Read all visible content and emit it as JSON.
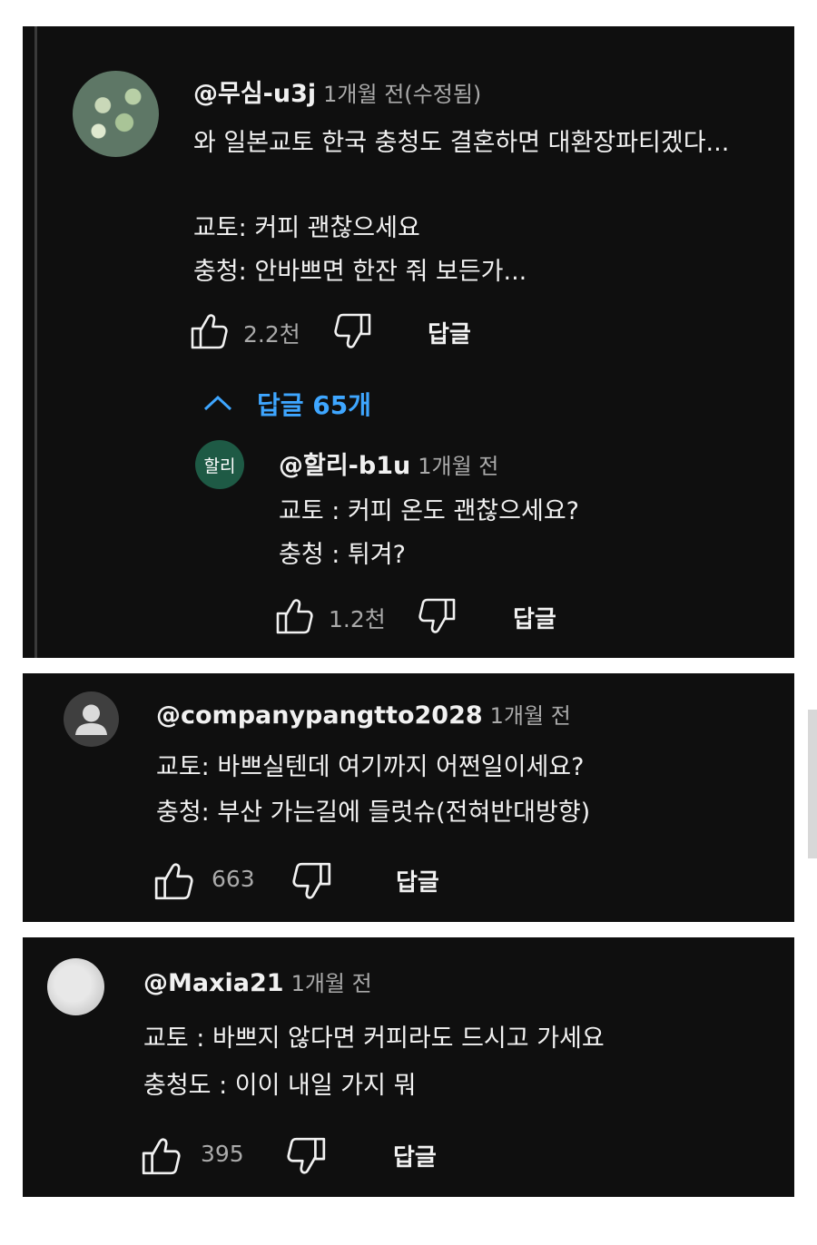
{
  "comments": [
    {
      "author": "@무심-u3j",
      "time": "1개월 전(수정됨)",
      "lines": [
        "와 일본교토 한국 충청도 결혼하면 대환장파티겠다...",
        "",
        "교토: 커피 괜찮으세요",
        "충청: 안바쁘면 한잔 줘 보든가..."
      ],
      "likes": "2.2천",
      "reply_label": "답글",
      "replies_toggle": "답글 65개",
      "reply": {
        "avatar_text": "할리",
        "avatar_color": "#1e5a45",
        "author": "@할리-b1u",
        "time": "1개월 전",
        "lines": [
          "교토 : 커피 온도 괜찮으세요?",
          "충청 : 튀겨?"
        ],
        "likes": "1.2천",
        "reply_label": "답글"
      }
    },
    {
      "author": "@companypangtto2028",
      "time": "1개월 전",
      "lines": [
        "교토: 바쁘실텐데 여기까지 어쩐일이세요?",
        "충청: 부산 가는길에 들럿슈(전혀반대방향)"
      ],
      "likes": "663",
      "reply_label": "답글"
    },
    {
      "author": "@Maxia21",
      "time": "1개월 전",
      "lines": [
        "교토 : 바쁘지 않다면 커피라도 드시고 가세요",
        "충청도 : 이이 내일 가지 뭐"
      ],
      "likes": "395",
      "reply_label": "답글"
    }
  ],
  "colors": {
    "background": "#0f0f0f",
    "text": "#f1f1f1",
    "secondary": "#aaaaaa",
    "link": "#3ea6ff"
  },
  "icons": [
    "like-icon",
    "dislike-icon",
    "chevron-up-icon"
  ]
}
